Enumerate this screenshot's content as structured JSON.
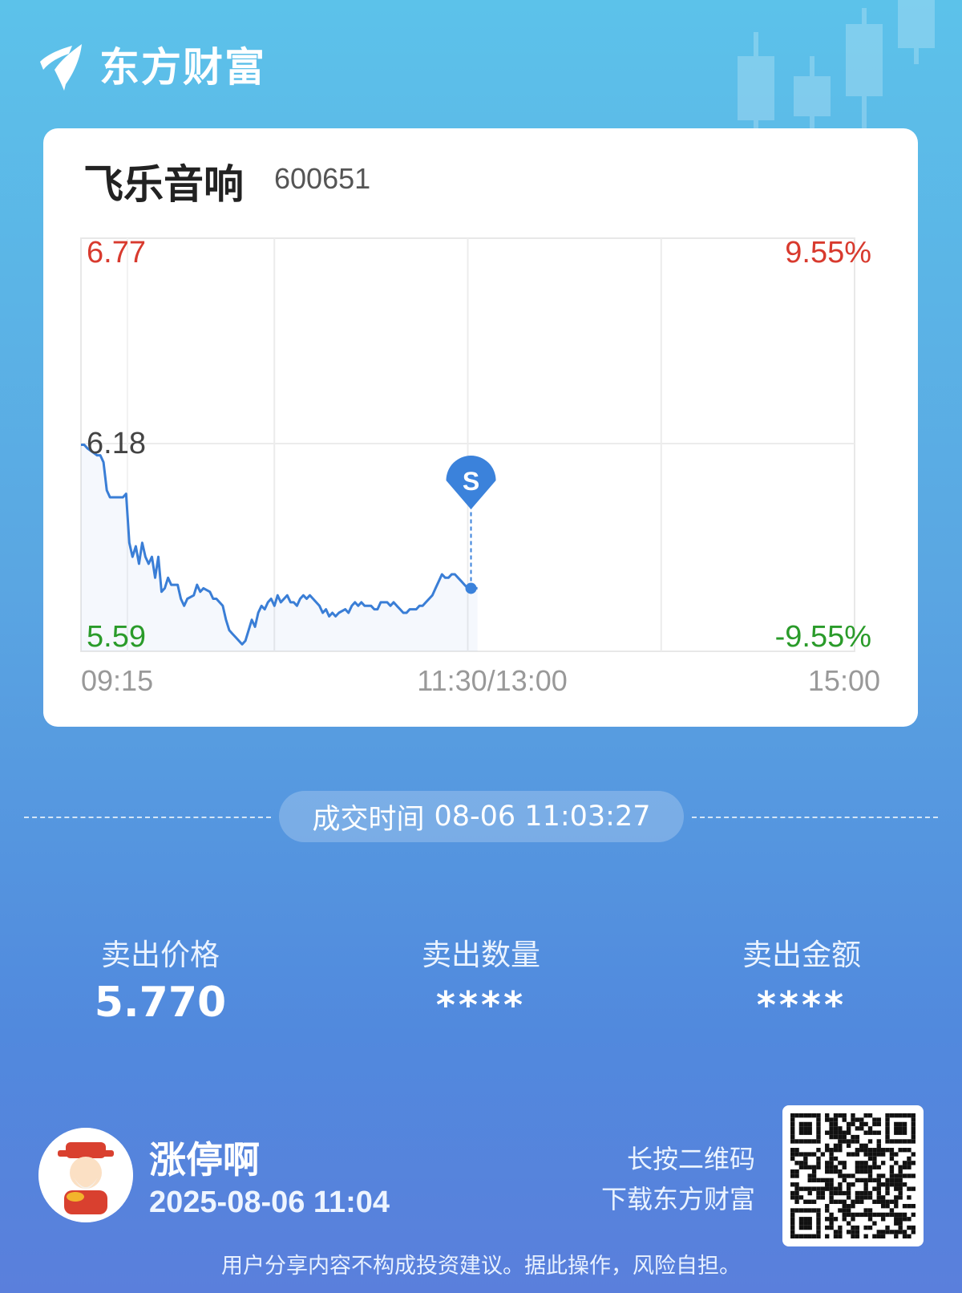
{
  "brand": {
    "name": "东方财富"
  },
  "stock": {
    "name": "飞乐音响",
    "code": "600651"
  },
  "chart_data": {
    "type": "line",
    "title": "",
    "y_max": 6.77,
    "y_mid": 6.18,
    "y_min": 5.59,
    "pct_max": "9.55%",
    "pct_min": "-9.55%",
    "y_labels": {
      "top": "6.77",
      "mid": "6.18",
      "bottom": "5.59"
    },
    "pct_labels": {
      "top": "9.55%",
      "bottom": "-9.55%"
    },
    "x_labels": {
      "open": "09:15",
      "mid": "11:30/13:00",
      "close": "15:00"
    },
    "x_range_minutes": [
      0,
      240
    ],
    "grid": true,
    "series": [
      {
        "values": [
          [
            0,
            6.18
          ],
          [
            1,
            6.18
          ],
          [
            2,
            6.17
          ],
          [
            5,
            6.15
          ],
          [
            6,
            6.15
          ],
          [
            7,
            6.13
          ],
          [
            8,
            6.05
          ],
          [
            9,
            6.03
          ],
          [
            13,
            6.03
          ],
          [
            14,
            6.04
          ],
          [
            15,
            5.9
          ],
          [
            16,
            5.86
          ],
          [
            17,
            5.89
          ],
          [
            18,
            5.84
          ],
          [
            19,
            5.9
          ],
          [
            20,
            5.86
          ],
          [
            21,
            5.84
          ],
          [
            22,
            5.86
          ],
          [
            23,
            5.8
          ],
          [
            24,
            5.86
          ],
          [
            25,
            5.76
          ],
          [
            26,
            5.77
          ],
          [
            27,
            5.8
          ],
          [
            28,
            5.78
          ],
          [
            30,
            5.78
          ],
          [
            31,
            5.74
          ],
          [
            32,
            5.72
          ],
          [
            33,
            5.74
          ],
          [
            35,
            5.75
          ],
          [
            36,
            5.78
          ],
          [
            37,
            5.76
          ],
          [
            38,
            5.77
          ],
          [
            40,
            5.76
          ],
          [
            41,
            5.74
          ],
          [
            42,
            5.74
          ],
          [
            44,
            5.72
          ],
          [
            45,
            5.68
          ],
          [
            46,
            5.65
          ],
          [
            47,
            5.64
          ],
          [
            48,
            5.63
          ],
          [
            49,
            5.62
          ],
          [
            50,
            5.61
          ],
          [
            51,
            5.62
          ],
          [
            52,
            5.65
          ],
          [
            53,
            5.68
          ],
          [
            54,
            5.66
          ],
          [
            55,
            5.7
          ],
          [
            56,
            5.72
          ],
          [
            57,
            5.71
          ],
          [
            58,
            5.73
          ],
          [
            59,
            5.74
          ],
          [
            60,
            5.72
          ],
          [
            61,
            5.75
          ],
          [
            62,
            5.73
          ],
          [
            63,
            5.74
          ],
          [
            64,
            5.75
          ],
          [
            65,
            5.73
          ],
          [
            66,
            5.73
          ],
          [
            67,
            5.72
          ],
          [
            68,
            5.74
          ],
          [
            69,
            5.75
          ],
          [
            70,
            5.74
          ],
          [
            71,
            5.75
          ],
          [
            72,
            5.74
          ],
          [
            73,
            5.73
          ],
          [
            74,
            5.72
          ],
          [
            75,
            5.7
          ],
          [
            76,
            5.71
          ],
          [
            77,
            5.69
          ],
          [
            78,
            5.7
          ],
          [
            79,
            5.69
          ],
          [
            80,
            5.7
          ],
          [
            82,
            5.71
          ],
          [
            83,
            5.7
          ],
          [
            84,
            5.72
          ],
          [
            85,
            5.73
          ],
          [
            86,
            5.72
          ],
          [
            87,
            5.73
          ],
          [
            88,
            5.72
          ],
          [
            89,
            5.72
          ],
          [
            90,
            5.72
          ],
          [
            91,
            5.71
          ],
          [
            92,
            5.71
          ],
          [
            93,
            5.73
          ],
          [
            94,
            5.73
          ],
          [
            95,
            5.73
          ],
          [
            96,
            5.72
          ],
          [
            97,
            5.73
          ],
          [
            98,
            5.72
          ],
          [
            99,
            5.71
          ],
          [
            100,
            5.7
          ],
          [
            101,
            5.7
          ],
          [
            102,
            5.71
          ],
          [
            103,
            5.71
          ],
          [
            104,
            5.71
          ],
          [
            105,
            5.72
          ],
          [
            106,
            5.72
          ],
          [
            107,
            5.73
          ],
          [
            108,
            5.74
          ],
          [
            109,
            5.75
          ],
          [
            110,
            5.77
          ],
          [
            111,
            5.79
          ],
          [
            112,
            5.81
          ],
          [
            113,
            5.8
          ],
          [
            114,
            5.8
          ],
          [
            115,
            5.81
          ],
          [
            116,
            5.81
          ],
          [
            117,
            5.8
          ],
          [
            118,
            5.79
          ],
          [
            119,
            5.78
          ],
          [
            120,
            5.77
          ],
          [
            121,
            5.78
          ],
          [
            122,
            5.77
          ],
          [
            123,
            5.77
          ]
        ]
      }
    ],
    "trade_marker": {
      "label": "S",
      "time": 121,
      "price": 5.77
    }
  },
  "trade": {
    "time_label": "成交时间",
    "time_value": "08-06 11:03:27"
  },
  "stats": [
    {
      "label": "卖出价格",
      "value": "5.770"
    },
    {
      "label": "卖出数量",
      "value": "****"
    },
    {
      "label": "卖出金额",
      "value": "****"
    }
  ],
  "user": {
    "name": "涨停啊",
    "share_time": "2025-08-06 11:04"
  },
  "qr": {
    "hint_line1": "长按二维码",
    "hint_line2": "下载东方财富"
  },
  "disclaimer": "用户分享内容不构成投资建议。据此操作，风险自担。",
  "colors": {
    "up": "#d83a2e",
    "down": "#2a9b2a",
    "line": "#3a7ed6",
    "marker": "#3b82db"
  }
}
